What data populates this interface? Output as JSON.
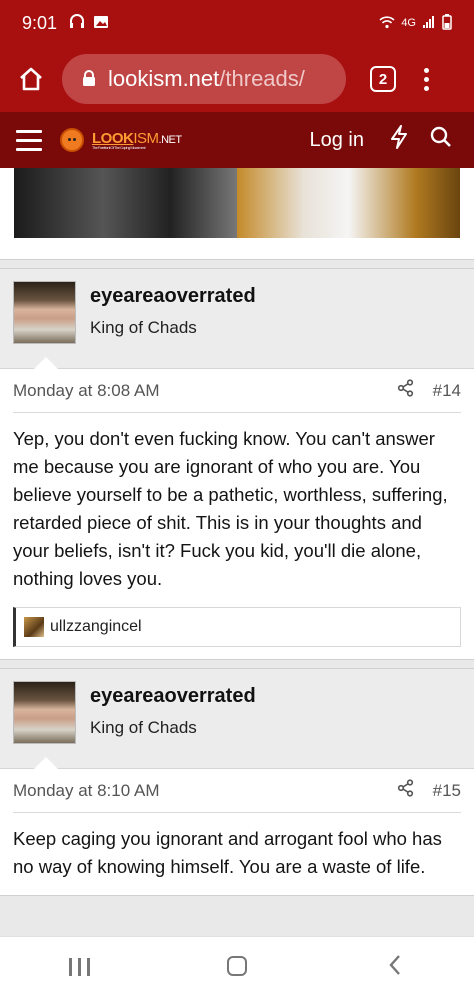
{
  "status": {
    "time": "9:01",
    "network": "4G"
  },
  "browser": {
    "url_host": "lookism.net",
    "url_path": "/threads/",
    "tab_count": "2"
  },
  "site": {
    "logo_look": "LOOK",
    "logo_ism": "ISM",
    "logo_net": ".NET",
    "logo_tagline": "The Forefront Of The Coping Movement",
    "login_label": "Log in"
  },
  "posts": [
    {
      "username": "eyeareaoverrated",
      "user_title": "King of Chads",
      "date": "Monday at 8:08 AM",
      "number": "#14",
      "body": "Yep, you don't even fucking know. You can't answer me because you are ignorant of who you are. You believe yourself to be a pathetic, worthless, suffering, retarded piece of shit. This is in your thoughts and your beliefs, isn't it? Fuck you kid, you'll die alone, nothing loves you.",
      "reaction_user": "ullzzangincel"
    },
    {
      "username": "eyeareaoverrated",
      "user_title": "King of Chads",
      "date": "Monday at 8:10 AM",
      "number": "#15",
      "body": "Keep caging you ignorant and arrogant fool who has no way of knowing himself. You are a waste of life."
    }
  ]
}
